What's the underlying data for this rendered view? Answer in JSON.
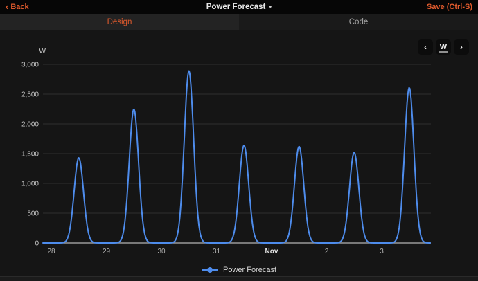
{
  "header": {
    "back_label": "Back",
    "title": "Power Forecast",
    "unsaved_indicator": "•",
    "save_label": "Save (Ctrl-S)"
  },
  "tabs": {
    "design": {
      "label": "Design",
      "active": true
    },
    "code": {
      "label": "Code",
      "active": false
    }
  },
  "icons": {
    "back_chevron": "‹",
    "prev_period": "‹",
    "next_period": "›"
  },
  "period_toolbar": {
    "period_label": "W"
  },
  "colors": {
    "accent_orange": "#e15b2d",
    "line_blue": "#4e8cec",
    "grid_line": "#303030",
    "axis_line": "#9a9a9a",
    "tick_label": "#c8c8c8",
    "bg_header": "#060606",
    "bg_content": "#151515"
  },
  "chart_data": {
    "type": "line",
    "series_name": "Power Forecast",
    "unit": "W",
    "ylabel": "W",
    "ylim": [
      0,
      3000
    ],
    "y_ticks": [
      0,
      500,
      1000,
      1500,
      2000,
      2500,
      3000
    ],
    "x_tick_labels": [
      "28",
      "29",
      "30",
      "31",
      "Nov",
      "2",
      "3"
    ],
    "x_bold_label": "Nov",
    "xlim_days": [
      -0.151,
      6.89
    ],
    "grid": true,
    "legend_position": "bottom",
    "line_color": "#4e8cec",
    "peak_sigma_days": 0.085,
    "peaks": [
      {
        "day": "Oct 28",
        "x": 0.5,
        "watts": 1430
      },
      {
        "day": "Oct 29",
        "x": 1.5,
        "watts": 2250
      },
      {
        "day": "Oct 30",
        "x": 2.5,
        "watts": 2890
      },
      {
        "day": "Oct 31",
        "x": 3.5,
        "watts": 1640
      },
      {
        "day": "Nov 1",
        "x": 4.5,
        "watts": 1620
      },
      {
        "day": "Nov 2",
        "x": 5.5,
        "watts": 1520
      },
      {
        "day": "Nov 3",
        "x": 6.5,
        "watts": 2610
      }
    ]
  },
  "legend": {
    "series_label": "Power Forecast"
  }
}
